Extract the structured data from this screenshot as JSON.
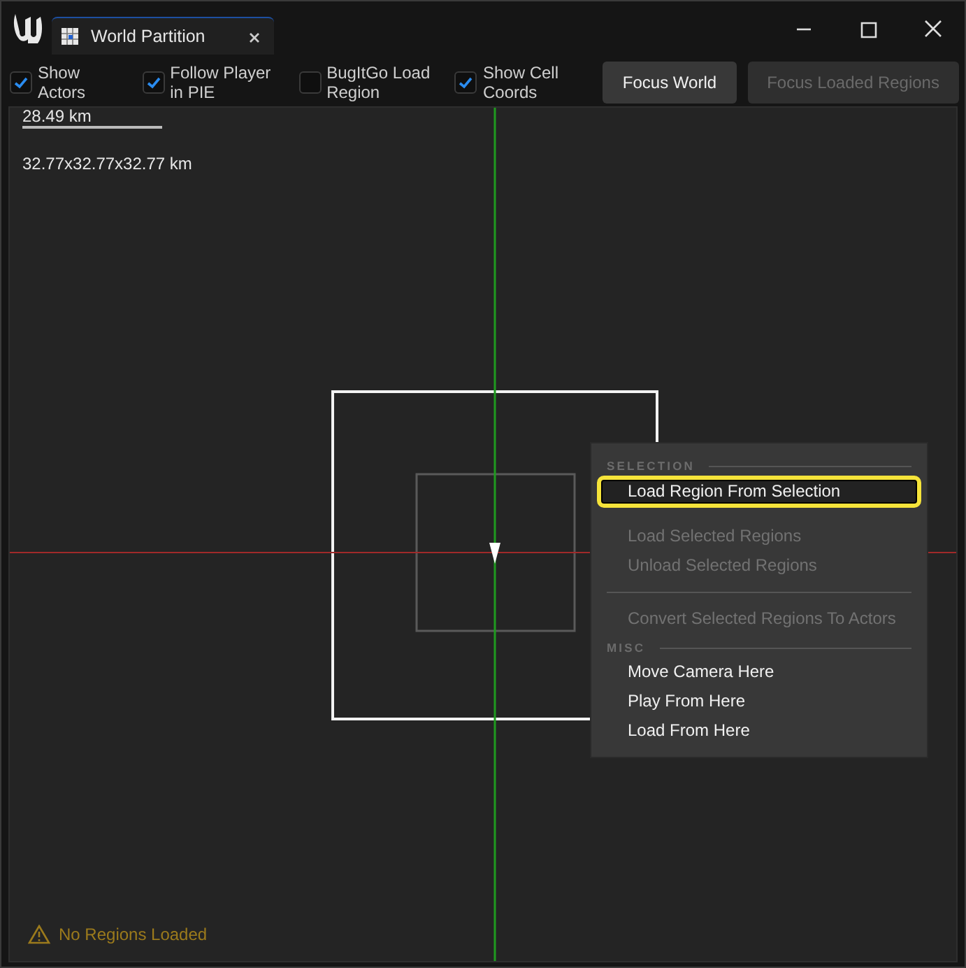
{
  "window": {
    "tab_title": "World Partition"
  },
  "toolbar": {
    "checkboxes": [
      {
        "label": "Show Actors",
        "checked": true
      },
      {
        "label": "Follow Player in PIE",
        "checked": true
      },
      {
        "label": "BugItGo Load Region",
        "checked": false
      },
      {
        "label": "Show Cell Coords",
        "checked": true
      }
    ],
    "buttons": [
      {
        "label": "Focus World",
        "disabled": false
      },
      {
        "label": "Focus Loaded Regions",
        "disabled": true
      }
    ]
  },
  "viewport": {
    "scale_label": "28.49 km",
    "world_size": "32.77x32.77x32.77 km",
    "status": "No Regions Loaded"
  },
  "context_menu": {
    "items": [
      {
        "kind": "header",
        "label": "SELECTION"
      },
      {
        "kind": "item",
        "label": "Load Region From Selection",
        "disabled": false,
        "selected": true
      },
      {
        "kind": "item",
        "label": "Load Selected Regions",
        "disabled": true,
        "selected": false
      },
      {
        "kind": "item",
        "label": "Unload Selected Regions",
        "disabled": true,
        "selected": false
      },
      {
        "kind": "separator"
      },
      {
        "kind": "item",
        "label": "Convert Selected Regions To Actors",
        "disabled": true,
        "selected": false
      },
      {
        "kind": "header",
        "label": "MISC"
      },
      {
        "kind": "item",
        "label": "Move Camera Here",
        "disabled": false,
        "selected": false
      },
      {
        "kind": "item",
        "label": "Play From Here",
        "disabled": false,
        "selected": false
      },
      {
        "kind": "item",
        "label": "Load From Here",
        "disabled": false,
        "selected": false
      }
    ]
  }
}
